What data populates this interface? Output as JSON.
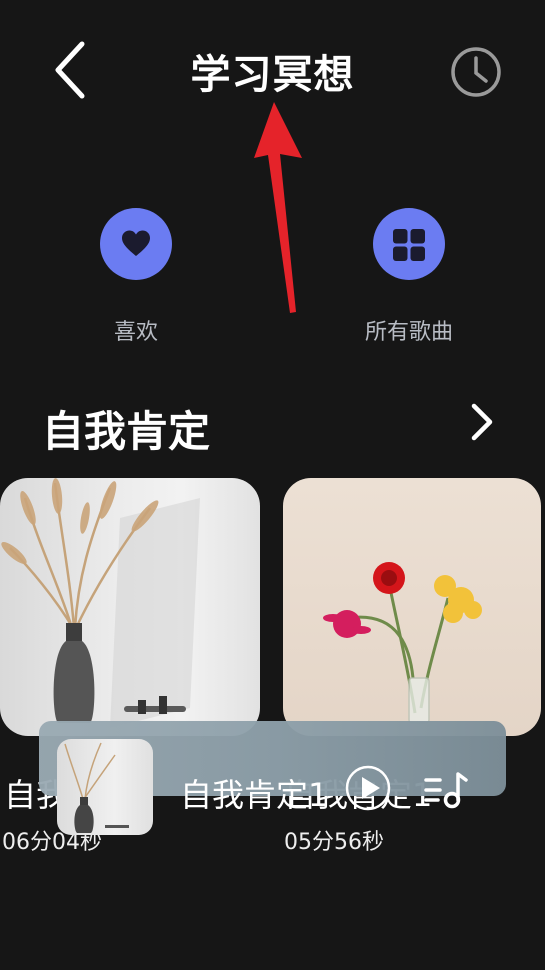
{
  "header": {
    "title": "学习冥想"
  },
  "quick": {
    "like_label": "喜欢",
    "all_label": "所有歌曲"
  },
  "section": {
    "title": "自我肯定"
  },
  "cards": [
    {
      "name": "自我",
      "duration": "06分04秒"
    },
    {
      "name": "自我肯定1",
      "duration": "05分56秒"
    }
  ],
  "player": {
    "title": "自我肯定1"
  },
  "colors": {
    "accent": "#6b7cf2",
    "background": "#161616",
    "annotation_arrow": "#e5232a"
  }
}
